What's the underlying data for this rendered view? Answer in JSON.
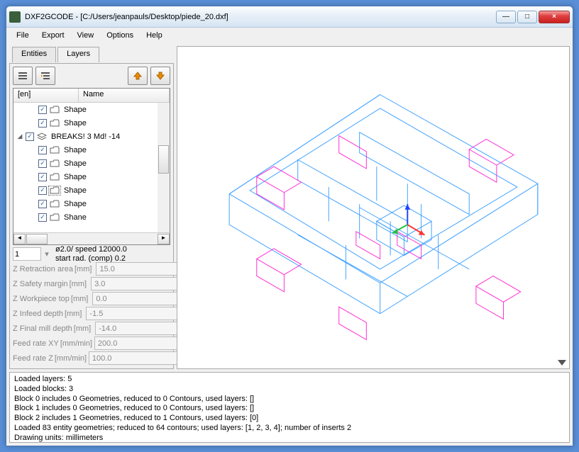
{
  "window": {
    "title": "DXF2GCODE - [C:/Users/jeanpauls/Desktop/piede_20.dxf]"
  },
  "menu": {
    "file": "File",
    "export": "Export",
    "view": "View",
    "options": "Options",
    "help": "Help"
  },
  "tabs": {
    "entities": "Entities",
    "layers": "Layers"
  },
  "tree": {
    "head_en": "[en]",
    "head_name": "Name",
    "rows": [
      {
        "indent": 1,
        "arrow": "",
        "checked": true,
        "icon": "folder",
        "label": "Shape"
      },
      {
        "indent": 1,
        "arrow": "",
        "checked": true,
        "icon": "folder",
        "label": "Shape"
      },
      {
        "indent": 0,
        "arrow": "◢",
        "checked": true,
        "icon": "layer",
        "label": "BREAKS! 3 Md! -14"
      },
      {
        "indent": 1,
        "arrow": "",
        "checked": true,
        "icon": "folder",
        "label": "Shape"
      },
      {
        "indent": 1,
        "arrow": "",
        "checked": true,
        "icon": "folder",
        "label": "Shape"
      },
      {
        "indent": 1,
        "arrow": "",
        "checked": true,
        "icon": "folder",
        "label": "Shape"
      },
      {
        "indent": 1,
        "arrow": "",
        "checked": true,
        "icon": "folder-sel",
        "label": "Shape"
      },
      {
        "indent": 1,
        "arrow": "",
        "checked": true,
        "icon": "folder",
        "label": "Shape"
      },
      {
        "indent": 1,
        "arrow": "",
        "checked": true,
        "icon": "folder",
        "label": "Shane"
      }
    ]
  },
  "spin": {
    "value": "1",
    "desc1": "ø2.0/ speed 12000.0",
    "desc2": "start rad. (comp) 0.2"
  },
  "params": [
    {
      "label": "Z Retraction area",
      "unit": "[mm]",
      "value": "15.0"
    },
    {
      "label": "Z Safety margin",
      "unit": "[mm]",
      "value": "3.0"
    },
    {
      "label": "Z Workpiece top",
      "unit": "[mm]",
      "value": "0.0"
    },
    {
      "label": "Z Infeed depth",
      "unit": "[mm]",
      "value": "-1.5"
    },
    {
      "label": "Z Final mill depth",
      "unit": "[mm]",
      "value": "-14.0"
    },
    {
      "label": "Feed rate XY",
      "unit": "[mm/min]",
      "value": "200.0"
    },
    {
      "label": "Feed rate Z",
      "unit": "[mm/min]",
      "value": "100.0"
    }
  ],
  "log": [
    "Loaded layers: 5",
    "Loaded blocks: 3",
    "Block 0 includes 0 Geometries, reduced to 0 Contours, used layers: []",
    "Block 1 includes 0 Geometries, reduced to 0 Contours, used layers: []",
    "Block 2 includes 1 Geometries, reduced to 1 Contours, used layers: [0]",
    "Loaded 83 entity geometries; reduced to 64 contours; used layers: [1, 2, 3, 4]; number of inserts 2",
    "Drawing units: millimeters"
  ],
  "wbtn": {
    "min": "—",
    "max": "□",
    "close": "×"
  }
}
